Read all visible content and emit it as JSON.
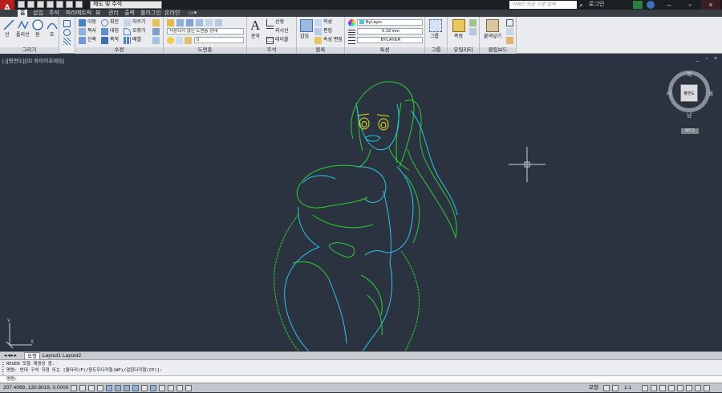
{
  "titlebar": {
    "app_letter": "A",
    "workspace": "제도 및 주석",
    "search_placeholder": "키워드 또는 구문 입력",
    "login": "로그인"
  },
  "menu_tabs": [
    "홈",
    "삽입",
    "주석",
    "파라메트릭",
    "뷰",
    "관리",
    "출력",
    "플러그인",
    "온라인"
  ],
  "ribbon": {
    "draw": {
      "title": "그리기",
      "tools": [
        "선",
        "폴리선",
        "원",
        "호"
      ]
    },
    "modify": {
      "title": "수정",
      "row1": [
        "이동",
        "회전",
        "자르기"
      ],
      "row2": [
        "복사",
        "대칭",
        "모깎기"
      ],
      "row3": [
        "신축",
        "축척",
        "배열"
      ]
    },
    "layers": {
      "title": "도면층",
      "state_combo": "저장되지 않은 도면층 상태",
      "layer_combo": "0"
    },
    "annotation": {
      "title": "주석",
      "big": "문자",
      "items": [
        "선형",
        "지시선",
        "테이블"
      ]
    },
    "block": {
      "title": "블록",
      "big": "삽입",
      "items": [
        "작성",
        "편집",
        "속성 편집"
      ]
    },
    "properties": {
      "title": "특성",
      "color": "ByLayer",
      "lineweight": "0.18 mm",
      "linetype": "BYLAYER"
    },
    "groups": {
      "title": "그룹",
      "big": "그룹"
    },
    "utilities": {
      "title": "유틸리티",
      "big": "측정"
    },
    "clipboard": {
      "title": "클립보드",
      "big": "붙여넣기"
    }
  },
  "viewport": {
    "label": "[-][평면도][2D 와이어프레임]",
    "controls": "_ ▫ ×"
  },
  "viewcube": {
    "north": "북",
    "south": "남",
    "east": "동",
    "west": "서",
    "face": "평면도",
    "ucs": "WCS"
  },
  "ucs_icon": {
    "x": "X",
    "y": "Y"
  },
  "layout_tabs": [
    "모형",
    "Layout1",
    "Layout2"
  ],
  "command": {
    "history": [
      "REGEN 모형 재생성 중.",
      "명령: 반대 구석 지정 또는 [울타리(F)/윈도우다각형(WP)/걸침다각형(CP)]:"
    ],
    "prompt": "명령:"
  },
  "status": {
    "coords": "207.4099, 130.8019, 0.0000",
    "model": "모형",
    "scale": "1:1"
  },
  "colors": {
    "canvas": "#2b3340",
    "green_lines": "#27d12f",
    "cyan_lines": "#28c8e6",
    "yellow_lines": "#e3e31e",
    "crosshair": "#c8d0da"
  }
}
